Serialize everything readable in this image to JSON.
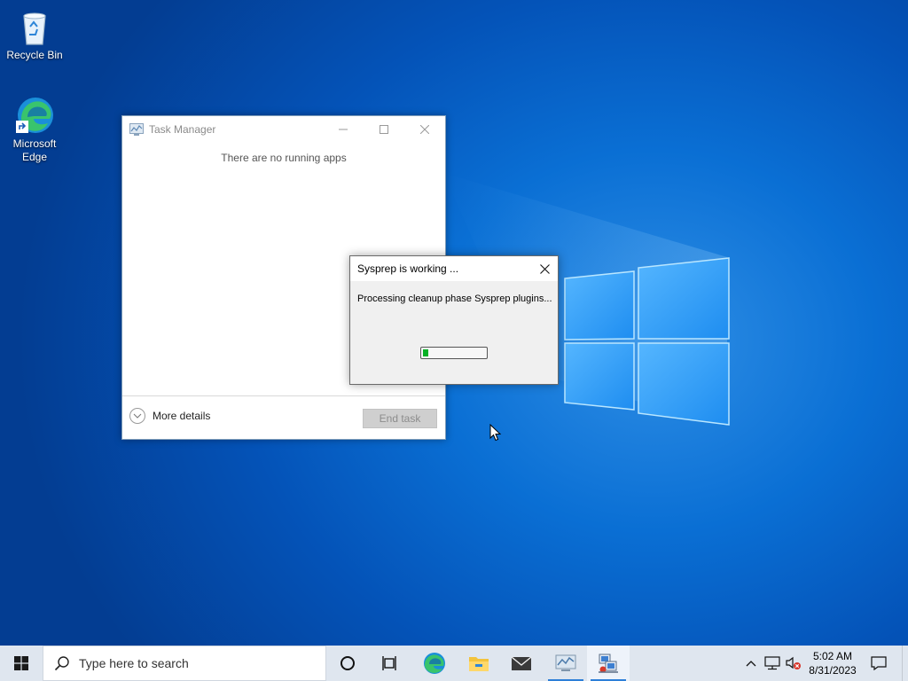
{
  "desktop": {
    "icons": [
      {
        "label": "Recycle Bin",
        "icon": "recycle-bin-icon"
      },
      {
        "label": "Microsoft Edge",
        "icon": "edge-icon"
      }
    ]
  },
  "task_manager": {
    "title": "Task Manager",
    "message": "There are no running apps",
    "more_details_label": "More details",
    "end_task_label": "End task"
  },
  "sysprep": {
    "title": "Sysprep is working ...",
    "message": "Processing cleanup phase Sysprep plugins...",
    "progress_fraction": 0.08
  },
  "taskbar": {
    "search_placeholder": "Type here to search",
    "apps": [
      "cortana-icon",
      "task-view-icon",
      "edge-icon",
      "file-explorer-icon",
      "mail-icon",
      "task-manager-icon",
      "sysprep-icon"
    ],
    "clock": {
      "time": "5:02 AM",
      "date": "8/31/2023"
    }
  },
  "colors": {
    "wallpaper": "#0a6fd4",
    "progress_fill": "#06b025",
    "taskbar": "#dfe6ef"
  }
}
